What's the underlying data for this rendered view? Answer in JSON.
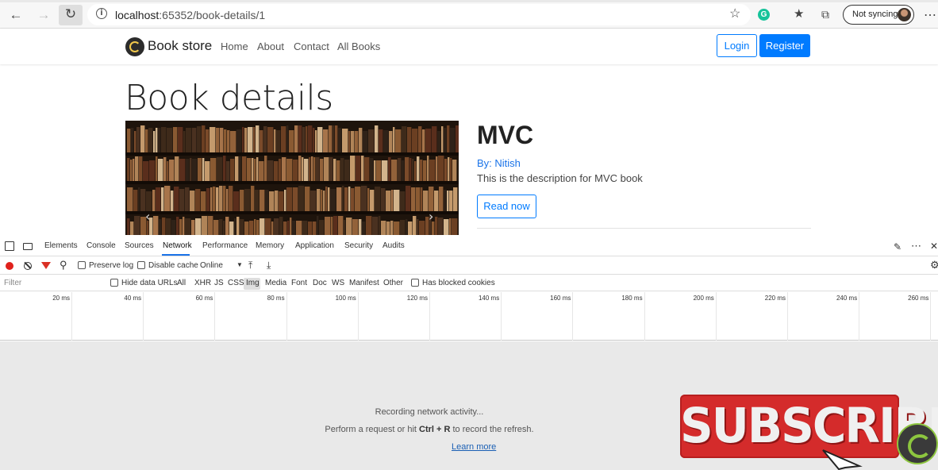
{
  "browser": {
    "url_host": "localhost",
    "url_rest": ":65352/book-details/1",
    "sync_label": "Not syncing"
  },
  "site": {
    "brand": "Book store",
    "nav": [
      "Home",
      "About",
      "Contact",
      "All Books"
    ],
    "login": "Login",
    "register": "Register"
  },
  "page": {
    "heading": "Book details",
    "book_title": "MVC",
    "author": "By: Nitish",
    "description": "This is the description for MVC book",
    "read_now": "Read now"
  },
  "devtools": {
    "tabs": [
      "Elements",
      "Console",
      "Sources",
      "Network",
      "Performance",
      "Memory",
      "Application",
      "Security",
      "Audits"
    ],
    "active_tab": "Network",
    "preserve_log": "Preserve log",
    "disable_cache": "Disable cache",
    "throttle": "Online",
    "filter_placeholder": "Filter",
    "hide_data_urls": "Hide data URLs",
    "types": [
      "All",
      "XHR",
      "JS",
      "CSS",
      "Img",
      "Media",
      "Font",
      "Doc",
      "WS",
      "Manifest",
      "Other"
    ],
    "active_type": "Img",
    "blocked_cookies": "Has blocked cookies",
    "ticks": [
      "20 ms",
      "40 ms",
      "60 ms",
      "80 ms",
      "100 ms",
      "120 ms",
      "140 ms",
      "160 ms",
      "180 ms",
      "200 ms",
      "220 ms",
      "240 ms",
      "260 ms"
    ],
    "recording": "Recording network activity...",
    "hint_pre": "Perform a request or hit ",
    "hint_keys": "Ctrl + R",
    "hint_post": " to record the refresh.",
    "learn_more": "Learn more"
  },
  "overlay": {
    "subscribe": "SUBSCRIBE"
  },
  "colors": {
    "primary": "#007bff",
    "record": "#e0211c",
    "subscribe": "#d42b2b"
  }
}
